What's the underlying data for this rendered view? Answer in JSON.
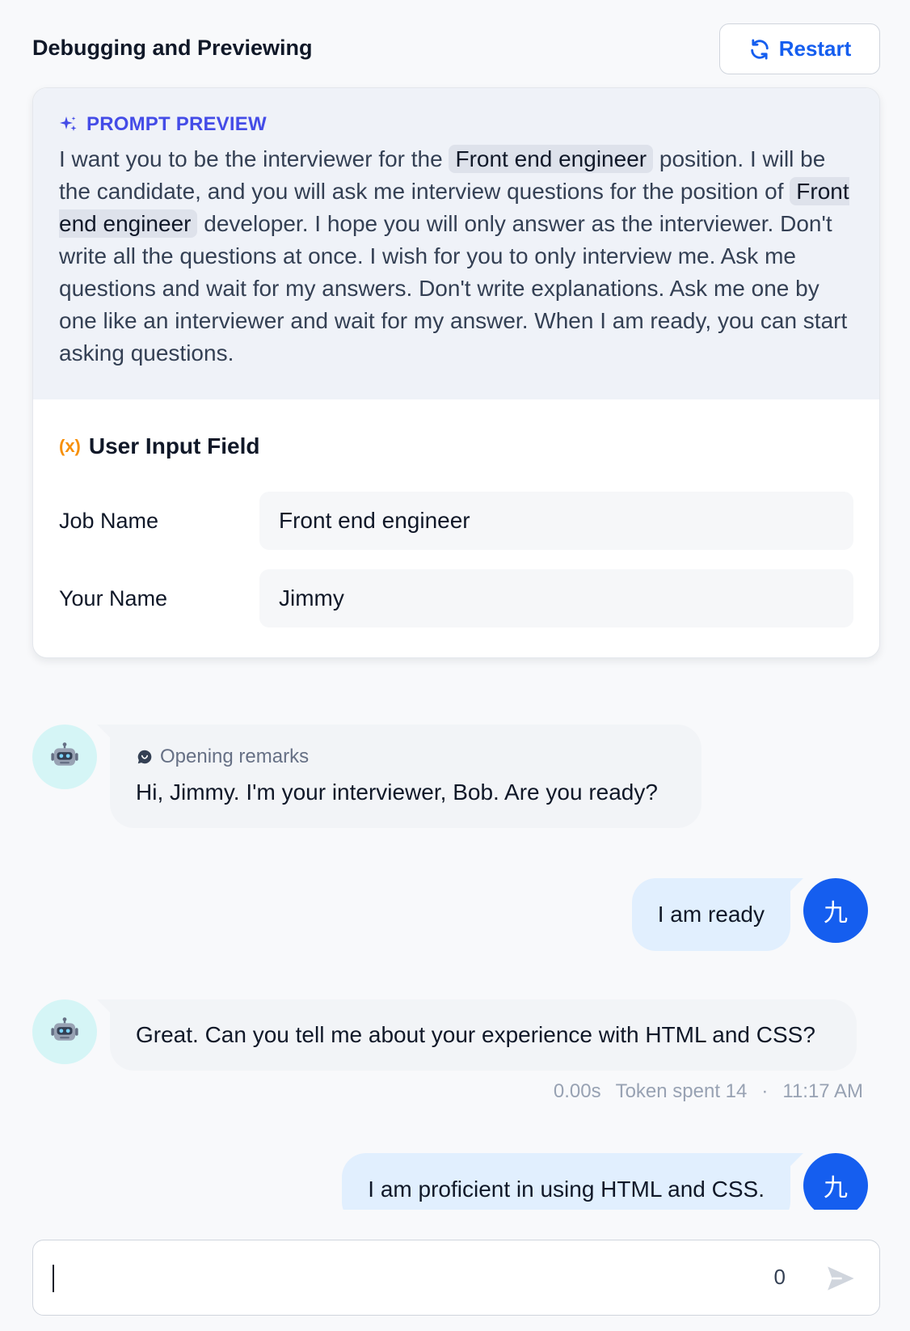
{
  "header": {
    "title": "Debugging and Previewing",
    "restart_label": "Restart"
  },
  "prompt_preview": {
    "label": "PROMPT PREVIEW",
    "segments": {
      "s1": "I want you to be the interviewer for the ",
      "var1": "Front end engineer",
      "s2": " position. I will be the candidate, and you will ask me interview questions for the position of ",
      "var2": "Front end engineer",
      "s3": " developer. I hope you will only answer as the interviewer. Don't write all the questions at once. I wish for you to only interview me. Ask me questions and wait for my answers. Don't write explanations. Ask me one by one like an interviewer and wait for my answer. When I am ready, you can start asking questions."
    }
  },
  "user_input": {
    "title": "User Input Field",
    "icon_text": "(x)",
    "fields": [
      {
        "label": "Job Name",
        "value": "Front end engineer"
      },
      {
        "label": "Your Name",
        "value": "Jimmy"
      }
    ]
  },
  "chat": {
    "opening_label": "Opening remarks",
    "messages": [
      {
        "role": "bot",
        "text": "Hi, Jimmy. I'm your interviewer, Bob. Are you ready?"
      },
      {
        "role": "user",
        "text": "I am ready"
      },
      {
        "role": "bot",
        "text": "Great. Can you tell me about your experience with HTML and CSS?"
      },
      {
        "role": "user",
        "text": "I am proficient in using HTML and CSS."
      }
    ],
    "meta": {
      "latency": "0.00s",
      "tokens": "Token spent 14",
      "separator": "·",
      "time": "11:17 AM"
    },
    "user_avatar_char": "九"
  },
  "composer": {
    "char_count": "0",
    "placeholder": ""
  },
  "colors": {
    "accent": "#155eef",
    "prompt_label": "#444ce7",
    "variable_icon": "#f79009"
  }
}
